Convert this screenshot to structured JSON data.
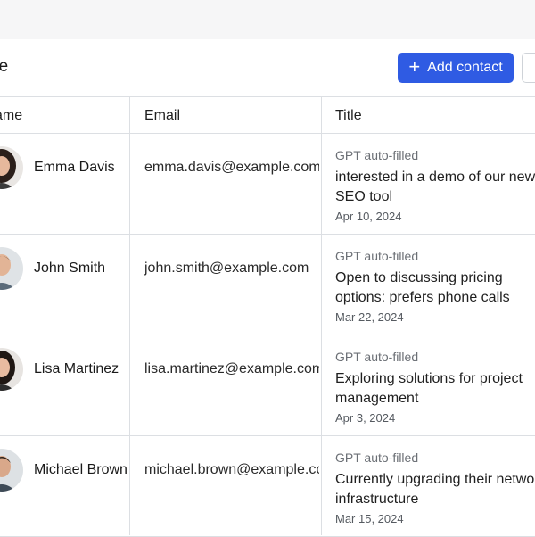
{
  "header": {
    "title": "ome",
    "add_button_label": "Add contact"
  },
  "table": {
    "columns": [
      "ame",
      "Email",
      "Title"
    ],
    "rows": [
      {
        "name": "Emma Davis",
        "email": "emma.davis@example.com",
        "source": "GPT auto-filled",
        "title": "interested in a demo of our new SEO tool",
        "date": "Apr 10, 2024"
      },
      {
        "name": "John Smith",
        "email": "john.smith@example.com",
        "source": "GPT auto-filled",
        "title": "Open to discussing pricing options: prefers phone calls",
        "date": "Mar 22, 2024"
      },
      {
        "name": "Lisa Martinez",
        "email": "lisa.martinez@example.com",
        "source": "GPT auto-filled",
        "title": "Exploring solutions for project management",
        "date": "Apr 3, 2024"
      },
      {
        "name": "Michael Brown",
        "email": "michael.brown@example.co",
        "source": "GPT auto-filled",
        "title": "Currently upgrading their network infrastructure",
        "date": "Mar 15, 2024"
      }
    ]
  },
  "colors": {
    "accent": "#2f5be3",
    "border": "#dcdfe3",
    "muted_text": "#6b6f75"
  }
}
